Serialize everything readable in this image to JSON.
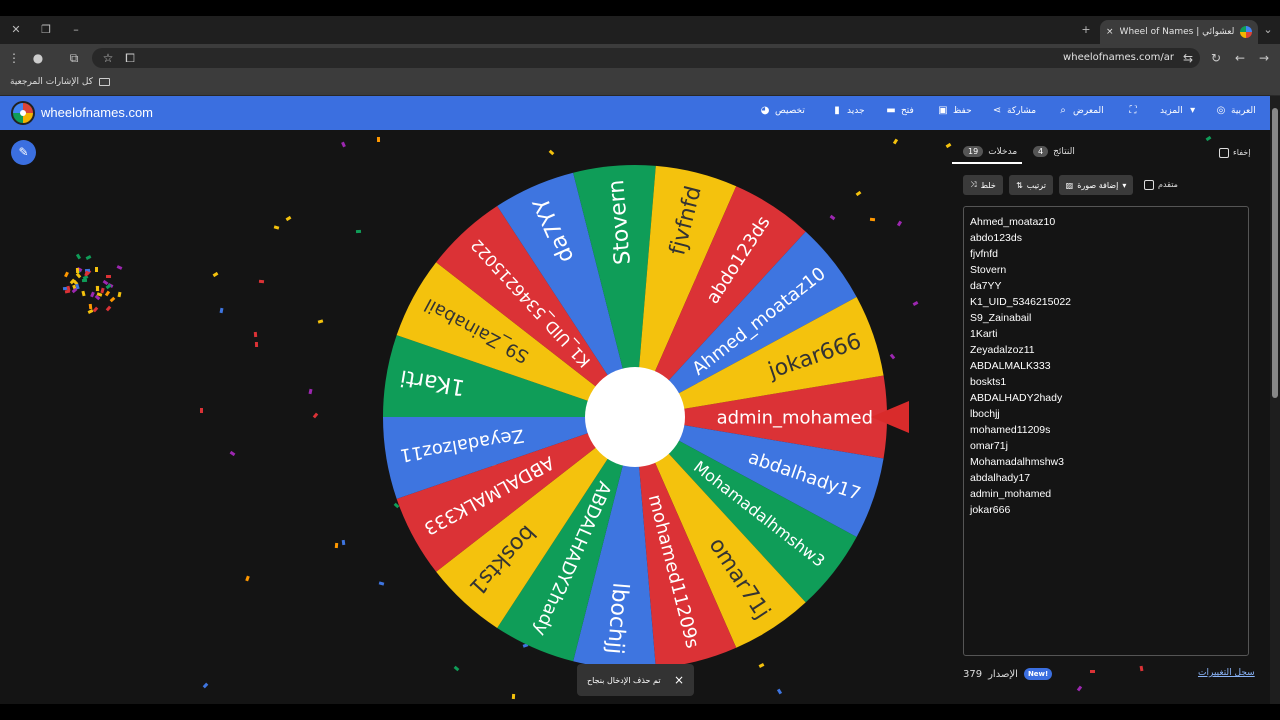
{
  "browser": {
    "tab_title": "Wheel of Names | اسم العشوائي",
    "url": "wheelofnames.com/ar",
    "bookmarks_label": "كل الإشارات المرجعية",
    "new_tab": "+",
    "tab_close": "×"
  },
  "app": {
    "site_name": "wheelofnames.com",
    "menu": {
      "customize": "تخصيص",
      "new": "جديد",
      "open": "فتح",
      "save": "حفظ",
      "share": "مشاركة",
      "gallery": "المعرض",
      "more": "المزيد",
      "language": "العربية"
    }
  },
  "wheel": {
    "segments": [
      {
        "label": "admin_mohamed",
        "color": "#db3236"
      },
      {
        "label": "abdalhady17",
        "color": "#3e75e0"
      },
      {
        "label": "Mohamadalhmshw3",
        "color": "#0f9d58"
      },
      {
        "label": "omar71j",
        "color": "#f4c20d"
      },
      {
        "label": "mohamed11209s",
        "color": "#db3236"
      },
      {
        "label": "lbochjj",
        "color": "#3e75e0"
      },
      {
        "label": "ABDALHADY2hady",
        "color": "#0f9d58"
      },
      {
        "label": "boskts1",
        "color": "#f4c20d"
      },
      {
        "label": "ABDALMALK333",
        "color": "#db3236"
      },
      {
        "label": "Zeyadalzoz11",
        "color": "#3e75e0"
      },
      {
        "label": "1Karti",
        "color": "#0f9d58"
      },
      {
        "label": "S9_Zainabail",
        "color": "#f4c20d"
      },
      {
        "label": "K1_UID_5346215022",
        "color": "#db3236"
      },
      {
        "label": "da7YY",
        "color": "#3e75e0"
      },
      {
        "label": "Stovern",
        "color": "#0f9d58"
      },
      {
        "label": "fjvfnfd",
        "color": "#f4c20d"
      },
      {
        "label": "abdo123ds",
        "color": "#db3236"
      },
      {
        "label": "Ahmed_moataz10",
        "color": "#3e75e0"
      },
      {
        "label": "jokar666",
        "color": "#f4c20d"
      }
    ]
  },
  "panel": {
    "hide_label": "إخفاء",
    "tab_entries": "مدخلات",
    "tab_entries_count": "19",
    "tab_results": "النتائج",
    "tab_results_count": "4",
    "shuffle_label": "خلط",
    "sort_label": "ترتيب",
    "add_image_label": "إضافة صورة",
    "advanced_label": "متقدم",
    "entries": [
      "Ahmed_moataz10",
      "abdo123ds",
      "fjvfnfd",
      "Stovern",
      "da7YY",
      "K1_UID_5346215022",
      "S9_Zainabail",
      "1Karti",
      "Zeyadalzoz11",
      "ABDALMALK333",
      "boskts1",
      "ABDALHADY2hady",
      "lbochjj",
      "mohamed11209s",
      "omar71j",
      "Mohamadalhmshw3",
      "abdalhady17",
      "admin_mohamed",
      "jokar666"
    ],
    "version_label": "الإصدار",
    "version_number": "379",
    "new_badge": "New!",
    "changelog_link": "سجل التغييرات"
  },
  "toast": {
    "message": "تم حذف الإدخال بنجاح",
    "close": "×"
  }
}
